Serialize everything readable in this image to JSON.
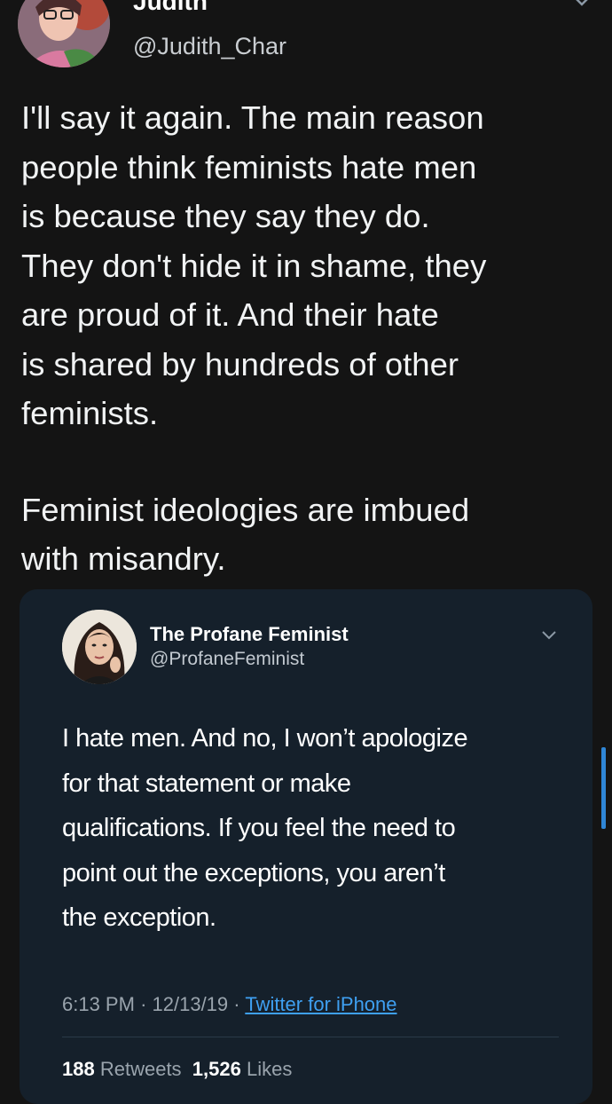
{
  "tweet": {
    "author_name": "Judith",
    "author_handle": "@Judith_Char",
    "lines": [
      "I'll say it again. The main reason",
      "people think feminists hate men",
      "is because they say they do.",
      "They don't hide it in shame, they",
      "are proud of it. And their hate",
      "is shared by hundreds of other",
      "feminists."
    ],
    "lines2": [
      "Feminist ideologies are imbued",
      "with misandry."
    ]
  },
  "quoted": {
    "author_name": "The Profane Feminist",
    "author_handle": "@ProfaneFeminist",
    "lines": [
      "I hate men. And no, I won’t apologize",
      "for that statement or make",
      "qualifications. If you feel the need to",
      "point out the exceptions, you aren’t",
      "the exception."
    ],
    "time": "6:13 PM",
    "date": "12/13/19",
    "separator": "·",
    "source": "Twitter for iPhone",
    "retweets_count": "188",
    "retweets_label": "Retweets",
    "likes_count": "1,526",
    "likes_label": "Likes"
  },
  "colors": {
    "background": "#141414",
    "card": "#15202b",
    "link": "#3fa0f2",
    "scroll": "#2f86d6"
  },
  "icons": [
    "chevron-down-icon",
    "avatar"
  ]
}
